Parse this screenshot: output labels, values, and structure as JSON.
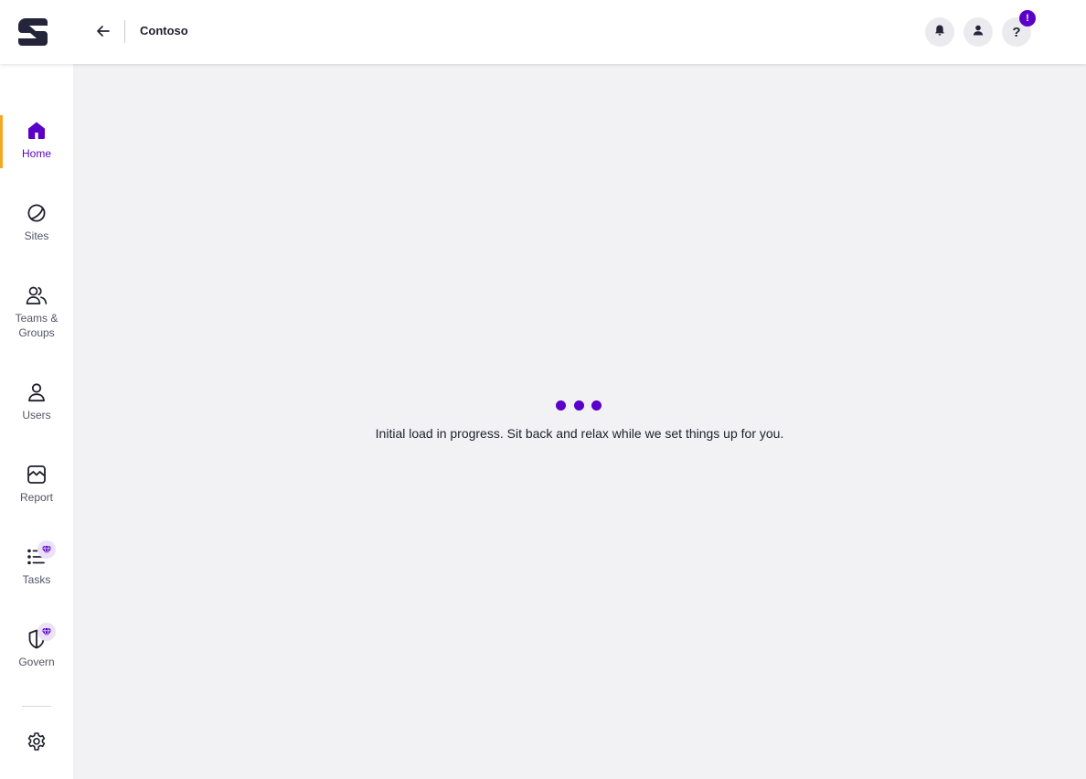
{
  "header": {
    "tenant_name": "Contoso",
    "help_badge": "!",
    "help_glyph": "?",
    "icons": {
      "logo": "brand-logo",
      "back": "arrow-left-icon",
      "notifications": "bell-icon",
      "profile": "user-icon",
      "help": "question-icon"
    }
  },
  "sidebar": {
    "items": [
      {
        "label": "Home",
        "icon": "home-icon",
        "active": true
      },
      {
        "label": "Sites",
        "icon": "globe-icon"
      },
      {
        "label": "Teams & Groups",
        "icon": "people-icon"
      },
      {
        "label": "Users",
        "icon": "user-icon"
      },
      {
        "label": "Report",
        "icon": "chart-icon"
      },
      {
        "label": "Tasks",
        "icon": "task-list-icon",
        "premium": true
      },
      {
        "label": "Govern",
        "icon": "shield-icon",
        "premium": true
      }
    ],
    "settings_icon": "gear-icon"
  },
  "main": {
    "loading_message": "Initial load in progress. Sit back and relax while we set things up for you."
  },
  "colors": {
    "accent": "#5a00c8",
    "active_indicator": "#f5a623",
    "content_background": "#f2f2f5"
  }
}
